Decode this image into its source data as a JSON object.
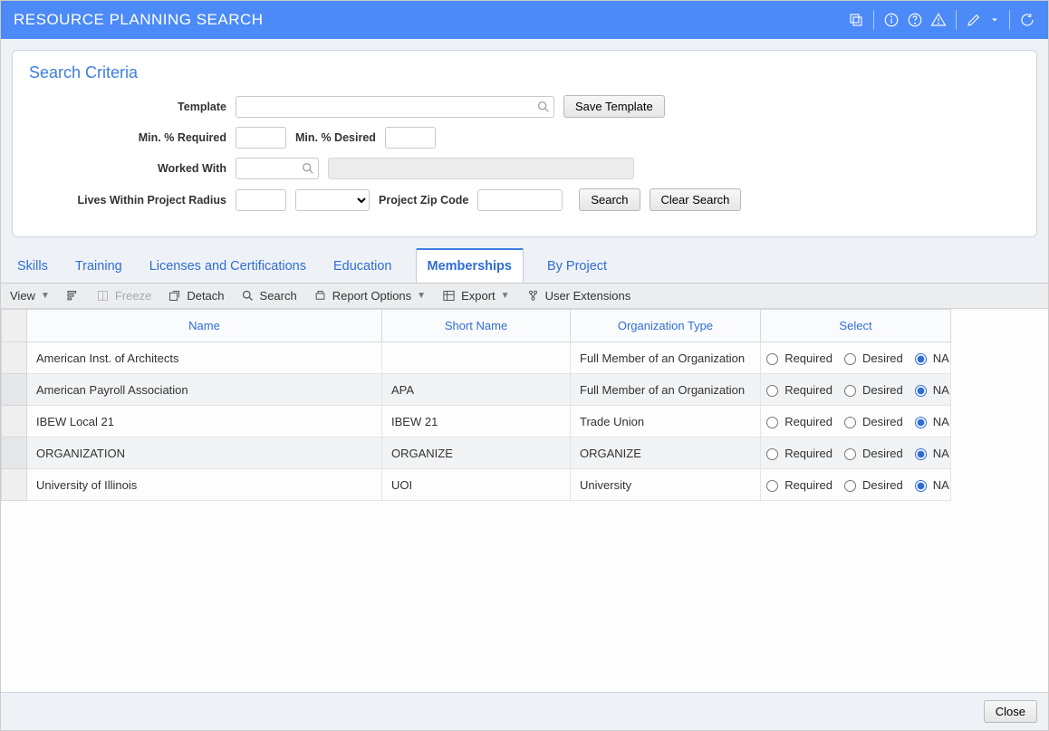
{
  "window": {
    "title": "RESOURCE PLANNING SEARCH"
  },
  "criteria": {
    "heading": "Search Criteria",
    "template_label": "Template",
    "save_template": "Save Template",
    "min_required_label": "Min. % Required",
    "min_desired_label": "Min. % Desired",
    "worked_with_label": "Worked With",
    "radius_label": "Lives Within Project Radius",
    "zip_label": "Project Zip Code",
    "search_btn": "Search",
    "clear_btn": "Clear Search"
  },
  "tabs": {
    "items": [
      "Skills",
      "Training",
      "Licenses and Certifications",
      "Education",
      "Memberships",
      "By Project"
    ],
    "active_index": 4
  },
  "toolbar": {
    "view": "View",
    "freeze": "Freeze",
    "detach": "Detach",
    "search": "Search",
    "report": "Report Options",
    "export": "Export",
    "user_ext": "User Extensions"
  },
  "table": {
    "columns": [
      "Name",
      "Short Name",
      "Organization Type",
      "Select"
    ],
    "select_options": [
      "Required",
      "Desired",
      "NA"
    ],
    "rows": [
      {
        "name": "American Inst. of Architects",
        "short": "",
        "org_type": "Full Member of an Organization",
        "select": "NA"
      },
      {
        "name": "American Payroll Association",
        "short": "APA",
        "org_type": "Full Member of an Organization",
        "select": "NA"
      },
      {
        "name": "IBEW Local 21",
        "short": "IBEW 21",
        "org_type": "Trade Union",
        "select": "NA"
      },
      {
        "name": "ORGANIZATION",
        "short": "ORGANIZE",
        "org_type": "ORGANIZE",
        "select": "NA"
      },
      {
        "name": "University of Illinois",
        "short": "UOI",
        "org_type": "University",
        "select": "NA"
      }
    ]
  },
  "footer": {
    "close": "Close"
  }
}
